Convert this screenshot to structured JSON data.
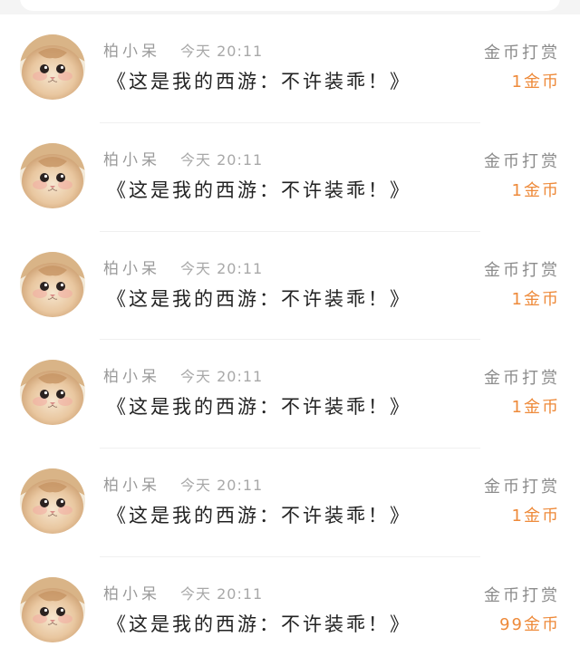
{
  "rows": [
    {
      "user": "柏小呆",
      "time": "今天 20:11",
      "title": "《这是我的西游：不许装乖！》",
      "reward_label": "金币打赏",
      "reward_amount": "1金币"
    },
    {
      "user": "柏小呆",
      "time": "今天 20:11",
      "title": "《这是我的西游：不许装乖！》",
      "reward_label": "金币打赏",
      "reward_amount": "1金币"
    },
    {
      "user": "柏小呆",
      "time": "今天 20:11",
      "title": "《这是我的西游：不许装乖！》",
      "reward_label": "金币打赏",
      "reward_amount": "1金币"
    },
    {
      "user": "柏小呆",
      "time": "今天 20:11",
      "title": "《这是我的西游：不许装乖！》",
      "reward_label": "金币打赏",
      "reward_amount": "1金币"
    },
    {
      "user": "柏小呆",
      "time": "今天 20:11",
      "title": "《这是我的西游：不许装乖！》",
      "reward_label": "金币打赏",
      "reward_amount": "1金币"
    },
    {
      "user": "柏小呆",
      "time": "今天 20:11",
      "title": "《这是我的西游：不许装乖！》",
      "reward_label": "金币打赏",
      "reward_amount": "99金币"
    }
  ],
  "colors": {
    "accent": "#ee8a3a",
    "muted": "#9a9a9a",
    "text": "#222222"
  },
  "avatar_icon": "cat-avatar-icon"
}
